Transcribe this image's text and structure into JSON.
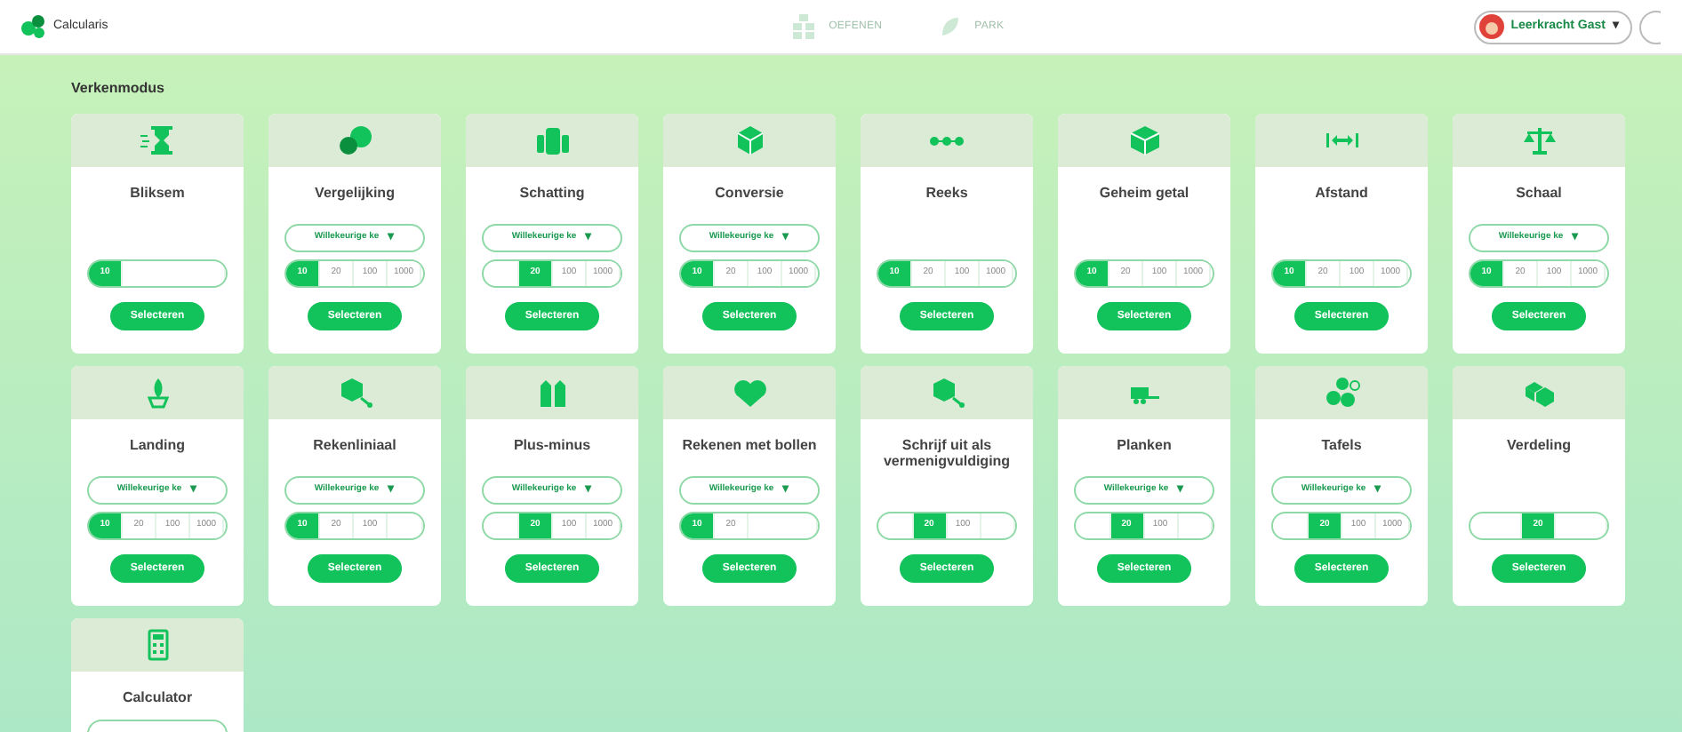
{
  "topbar": {
    "app_name": "Calcularis",
    "nav": [
      {
        "label": "OEFENEN",
        "disabled": true
      },
      {
        "label": "PARK",
        "disabled": true
      }
    ],
    "user": {
      "name": "Leerkracht Gast",
      "caret": "▾"
    }
  },
  "heading": "Verkenmodus",
  "cards": [
    {
      "title": "Bliksem",
      "range": [
        {
          "kind": "value",
          "label": "10",
          "selected": true
        },
        {
          "kind": "blank"
        }
      ],
      "button": "Selecteren"
    },
    {
      "title": "Vergelijking",
      "dropdown": {
        "label": "Willekeurige ke",
        "caret": "▾"
      },
      "range": [
        {
          "kind": "value",
          "label": "10",
          "selected": true
        },
        {
          "kind": "value",
          "label": "20",
          "selected": false
        },
        {
          "kind": "value",
          "label": "100",
          "selected": false
        },
        {
          "kind": "value",
          "label": "1000",
          "selected": false
        }
      ],
      "button": "Selecteren"
    },
    {
      "title": "Schatting",
      "dropdown": {
        "label": "Willekeurige ke",
        "caret": "▾"
      },
      "range": [
        {
          "kind": "blank"
        },
        {
          "kind": "value",
          "label": "20",
          "selected": true
        },
        {
          "kind": "value",
          "label": "100",
          "selected": false
        },
        {
          "kind": "value",
          "label": "1000",
          "selected": false
        }
      ],
      "button": "Selecteren"
    },
    {
      "title": "Conversie",
      "dropdown": {
        "label": "Willekeurige ke",
        "caret": "▾"
      },
      "range": [
        {
          "kind": "value",
          "label": "10",
          "selected": true
        },
        {
          "kind": "value",
          "label": "20",
          "selected": false
        },
        {
          "kind": "value",
          "label": "100",
          "selected": false
        },
        {
          "kind": "value",
          "label": "1000",
          "selected": false
        }
      ],
      "button": "Selecteren"
    },
    {
      "title": "Reeks",
      "range": [
        {
          "kind": "value",
          "label": "10",
          "selected": true
        },
        {
          "kind": "value",
          "label": "20",
          "selected": false
        },
        {
          "kind": "value",
          "label": "100",
          "selected": false
        },
        {
          "kind": "value",
          "label": "1000",
          "selected": false
        }
      ],
      "button": "Selecteren"
    },
    {
      "title": "Geheim getal",
      "range": [
        {
          "kind": "value",
          "label": "10",
          "selected": true
        },
        {
          "kind": "value",
          "label": "20",
          "selected": false
        },
        {
          "kind": "value",
          "label": "100",
          "selected": false
        },
        {
          "kind": "value",
          "label": "1000",
          "selected": false
        }
      ],
      "button": "Selecteren"
    },
    {
      "title": "Afstand",
      "range": [
        {
          "kind": "value",
          "label": "10",
          "selected": true
        },
        {
          "kind": "value",
          "label": "20",
          "selected": false
        },
        {
          "kind": "value",
          "label": "100",
          "selected": false
        },
        {
          "kind": "value",
          "label": "1000",
          "selected": false
        }
      ],
      "button": "Selecteren"
    },
    {
      "title": "Schaal",
      "dropdown": {
        "label": "Willekeurige ke",
        "caret": "▾"
      },
      "range": [
        {
          "kind": "value",
          "label": "10",
          "selected": true
        },
        {
          "kind": "value",
          "label": "20",
          "selected": false
        },
        {
          "kind": "value",
          "label": "100",
          "selected": false
        },
        {
          "kind": "value",
          "label": "1000",
          "selected": false
        }
      ],
      "button": "Selecteren"
    },
    {
      "title": "Landing",
      "dropdown": {
        "label": "Willekeurige ke",
        "caret": "▾"
      },
      "range": [
        {
          "kind": "value",
          "label": "10",
          "selected": true
        },
        {
          "kind": "value",
          "label": "20",
          "selected": false
        },
        {
          "kind": "value",
          "label": "100",
          "selected": false
        },
        {
          "kind": "value",
          "label": "1000",
          "selected": false
        }
      ],
      "button": "Selecteren"
    },
    {
      "title": "Rekenliniaal",
      "dropdown": {
        "label": "Willekeurige ke",
        "caret": "▾"
      },
      "range": [
        {
          "kind": "value",
          "label": "10",
          "selected": true
        },
        {
          "kind": "value",
          "label": "20",
          "selected": false
        },
        {
          "kind": "value",
          "label": "100",
          "selected": false
        },
        {
          "kind": "blank"
        }
      ],
      "button": "Selecteren"
    },
    {
      "title": "Plus-minus",
      "dropdown": {
        "label": "Willekeurige ke",
        "caret": "▾"
      },
      "range": [
        {
          "kind": "blank"
        },
        {
          "kind": "value",
          "label": "20",
          "selected": true
        },
        {
          "kind": "value",
          "label": "100",
          "selected": false
        },
        {
          "kind": "value",
          "label": "1000",
          "selected": false
        }
      ],
      "button": "Selecteren"
    },
    {
      "title": "Rekenen met bollen",
      "dropdown": {
        "label": "Willekeurige ke",
        "caret": "▾"
      },
      "range": [
        {
          "kind": "value",
          "label": "10",
          "selected": true
        },
        {
          "kind": "value",
          "label": "20",
          "selected": false
        },
        {
          "kind": "blank"
        }
      ],
      "button": "Selecteren"
    },
    {
      "title": "Schrijf uit als vermenigvuldiging",
      "range": [
        {
          "kind": "blank"
        },
        {
          "kind": "value",
          "label": "20",
          "selected": true
        },
        {
          "kind": "value",
          "label": "100",
          "selected": false
        },
        {
          "kind": "blank"
        }
      ],
      "button": "Selecteren"
    },
    {
      "title": "Planken",
      "dropdown": {
        "label": "Willekeurige ke",
        "caret": "▾"
      },
      "range": [
        {
          "kind": "blank"
        },
        {
          "kind": "value",
          "label": "20",
          "selected": true
        },
        {
          "kind": "value",
          "label": "100",
          "selected": false
        },
        {
          "kind": "blank"
        }
      ],
      "button": "Selecteren"
    },
    {
      "title": "Tafels",
      "dropdown": {
        "label": "Willekeurige ke",
        "caret": "▾"
      },
      "range": [
        {
          "kind": "blank"
        },
        {
          "kind": "value",
          "label": "20",
          "selected": true
        },
        {
          "kind": "value",
          "label": "100",
          "selected": false
        },
        {
          "kind": "value",
          "label": "1000",
          "selected": false
        }
      ],
      "button": "Selecteren"
    },
    {
      "title": "Verdeling",
      "range": [
        {
          "kind": "blank"
        },
        {
          "kind": "value",
          "label": "20",
          "selected": true
        },
        {
          "kind": "blank"
        }
      ],
      "button": "Selecteren"
    },
    {
      "title": "Calculator",
      "dropdown_outline": true
    }
  ]
}
